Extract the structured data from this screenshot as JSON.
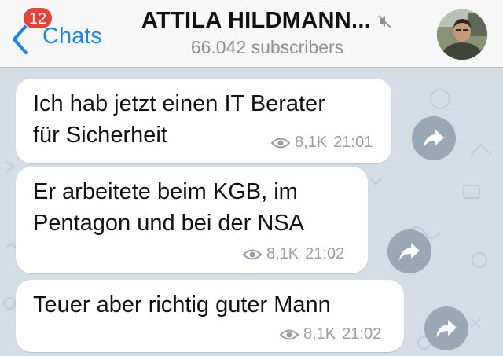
{
  "header": {
    "back_label": "Chats",
    "unread_count": "12",
    "title": "ATTILA HILDMANN...",
    "subscribers": "66.042 subscribers"
  },
  "icons": {
    "back": "chevron-left-icon",
    "mute": "muted-speaker-icon",
    "views": "eye-icon",
    "share": "share-arrow-icon"
  },
  "colors": {
    "accent": "#1a84f1",
    "badge": "#e4433a",
    "chat_background": "#d3dde6",
    "bubble": "#ffffff",
    "share_button": "#9aa8b6"
  },
  "messages": [
    {
      "lines": [
        "Ich hab jetzt einen IT Berater",
        "für Sicherheit"
      ],
      "views": "8,1K",
      "time": "21:01"
    },
    {
      "lines": [
        "Er arbeitete beim KGB, im",
        "Pentagon und bei der NSA"
      ],
      "views": "8,1K",
      "time": "21:02"
    },
    {
      "lines": [
        "Teuer aber richtig guter Mann"
      ],
      "views": "8,1K",
      "time": "21:02"
    }
  ]
}
